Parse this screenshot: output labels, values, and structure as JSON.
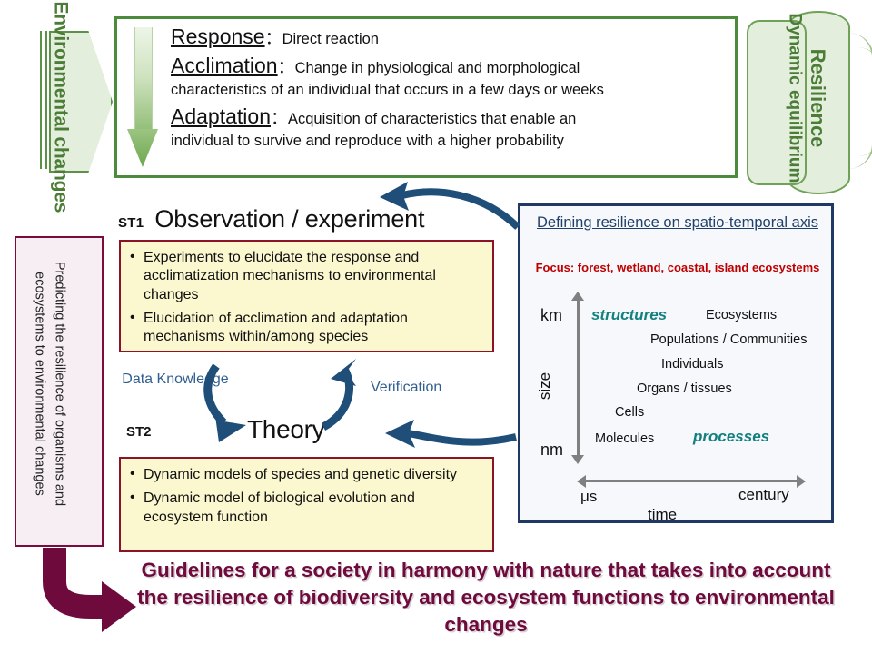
{
  "left_arrow": {
    "label": "Environmental changes"
  },
  "definitions": {
    "items": [
      {
        "term": "Response",
        "colon": "：",
        "body": "Direct  reaction",
        "cont": ""
      },
      {
        "term": "Acclimation",
        "colon": "：",
        "body": "Change in physiological and morphological",
        "cont": "characteristics of an individual that occurs in a few days or weeks"
      },
      {
        "term": "Adaptation",
        "colon": "：",
        "body": "Acquisition of characteristics that enable an",
        "cont": "individual to survive and reproduce with a higher probability"
      }
    ]
  },
  "right_shapes": {
    "resilience": "Resilience",
    "dynamic_equilibrium": "Dynamic equilibrium"
  },
  "predict_box": {
    "label": "Predicting the resilience of organisms and ecosystems to environmental changes"
  },
  "st1": {
    "tag": "ST1",
    "title": "Observation / experiment",
    "bullets": [
      "Experiments to elucidate the response and acclimatization mechanisms to environmental changes",
      "Elucidation of acclimation and adaptation mechanisms within/among species"
    ]
  },
  "st2": {
    "tag": "ST2",
    "title": "Theory",
    "bullets": [
      "Dynamic models of species and genetic diversity",
      "Dynamic model of biological evolution and ecosystem function"
    ]
  },
  "cycle_labels": {
    "down": "Data Knowledge",
    "up": "Verification"
  },
  "spatio_panel": {
    "title": "Defining resilience on spatio-temporal axis",
    "focus": "Focus: forest, wetland, coastal, island ecosystems",
    "size_axis": {
      "label": "size",
      "top": "km",
      "bottom": "nm"
    },
    "time_axis": {
      "label": "time",
      "left": "μs",
      "right": "century"
    },
    "group_structures": "structures",
    "group_processes": "processes",
    "levels": [
      "Ecosystems",
      "Populations / Communities",
      "Individuals",
      "Organs / tissues",
      "Cells",
      "Molecules"
    ]
  },
  "goal": {
    "text": "Guidelines for a society in harmony with nature that takes into account the resilience of biodiversity and ecosystem functions to environmental changes"
  },
  "colors": {
    "green": "#4b8b3b",
    "green_text": "#4b7d37",
    "green_fill": "#e4eedd",
    "navy": "#1f3864",
    "navy_arrow": "#1f4e79",
    "dark_red": "#8c1228",
    "maroon": "#6e0b3c",
    "yellow_fill": "#fbf8d0",
    "pink_fill": "#f7eef3",
    "teal": "#138080",
    "focus_red": "#c00000",
    "gray_axis": "#808080",
    "steel_blue": "#2f5f8f"
  }
}
